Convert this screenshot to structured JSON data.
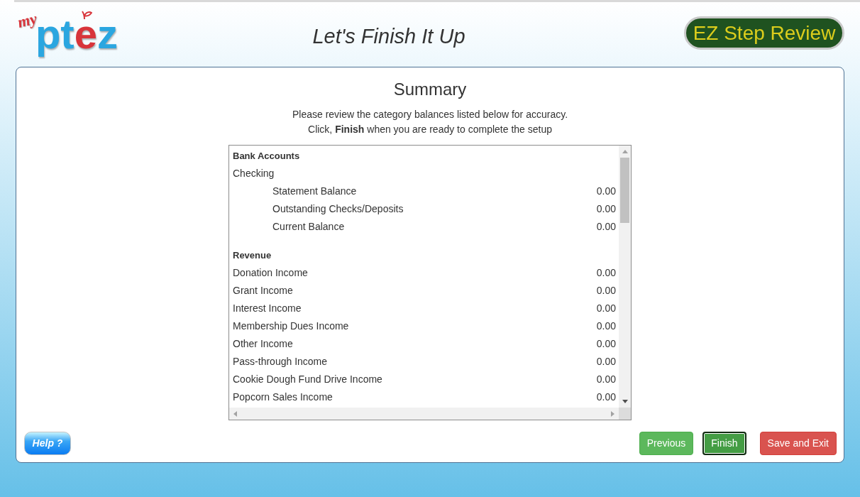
{
  "header": {
    "logo": {
      "script": "my",
      "wordmark": [
        {
          "text": "pt",
          "kind": "plain"
        },
        {
          "text": "e",
          "kind": "accent"
        },
        {
          "text": "z",
          "kind": "plain"
        }
      ]
    },
    "title": "Let's Finish It Up",
    "review_button": "EZ Step Review"
  },
  "summary": {
    "title": "Summary",
    "instructions": [
      "Please review the category balances listed below for accuracy.",
      "Click, **Finish** when you are ready to complete the setup"
    ],
    "sections": [
      {
        "heading": "Bank Accounts",
        "rows": [
          {
            "label": "Checking",
            "children": [
              {
                "label": "Statement Balance",
                "amount": "0.00"
              },
              {
                "label": "Outstanding Checks/Deposits",
                "amount": "0.00"
              },
              {
                "label": "Current Balance",
                "amount": "0.00"
              }
            ]
          }
        ]
      },
      {
        "heading": "Revenue",
        "rows": [
          {
            "label": "Donation Income",
            "amount": "0.00"
          },
          {
            "label": "Grant Income",
            "amount": "0.00"
          },
          {
            "label": "Interest Income",
            "amount": "0.00"
          },
          {
            "label": "Membership Dues Income",
            "amount": "0.00"
          },
          {
            "label": "Other Income",
            "amount": "0.00"
          },
          {
            "label": "Pass-through Income",
            "amount": "0.00"
          },
          {
            "label": "Cookie Dough Fund Drive Income",
            "amount": "0.00"
          },
          {
            "label": "Popcorn Sales Income",
            "amount": "0.00"
          }
        ]
      }
    ]
  },
  "footer": {
    "help_button": "Help ?",
    "actions": [
      {
        "label": "Previous",
        "kind": "success",
        "focused": false
      },
      {
        "label": "Finish",
        "kind": "success",
        "focused": true
      },
      {
        "label": "Save and Exit",
        "kind": "danger",
        "focused": false
      }
    ]
  }
}
